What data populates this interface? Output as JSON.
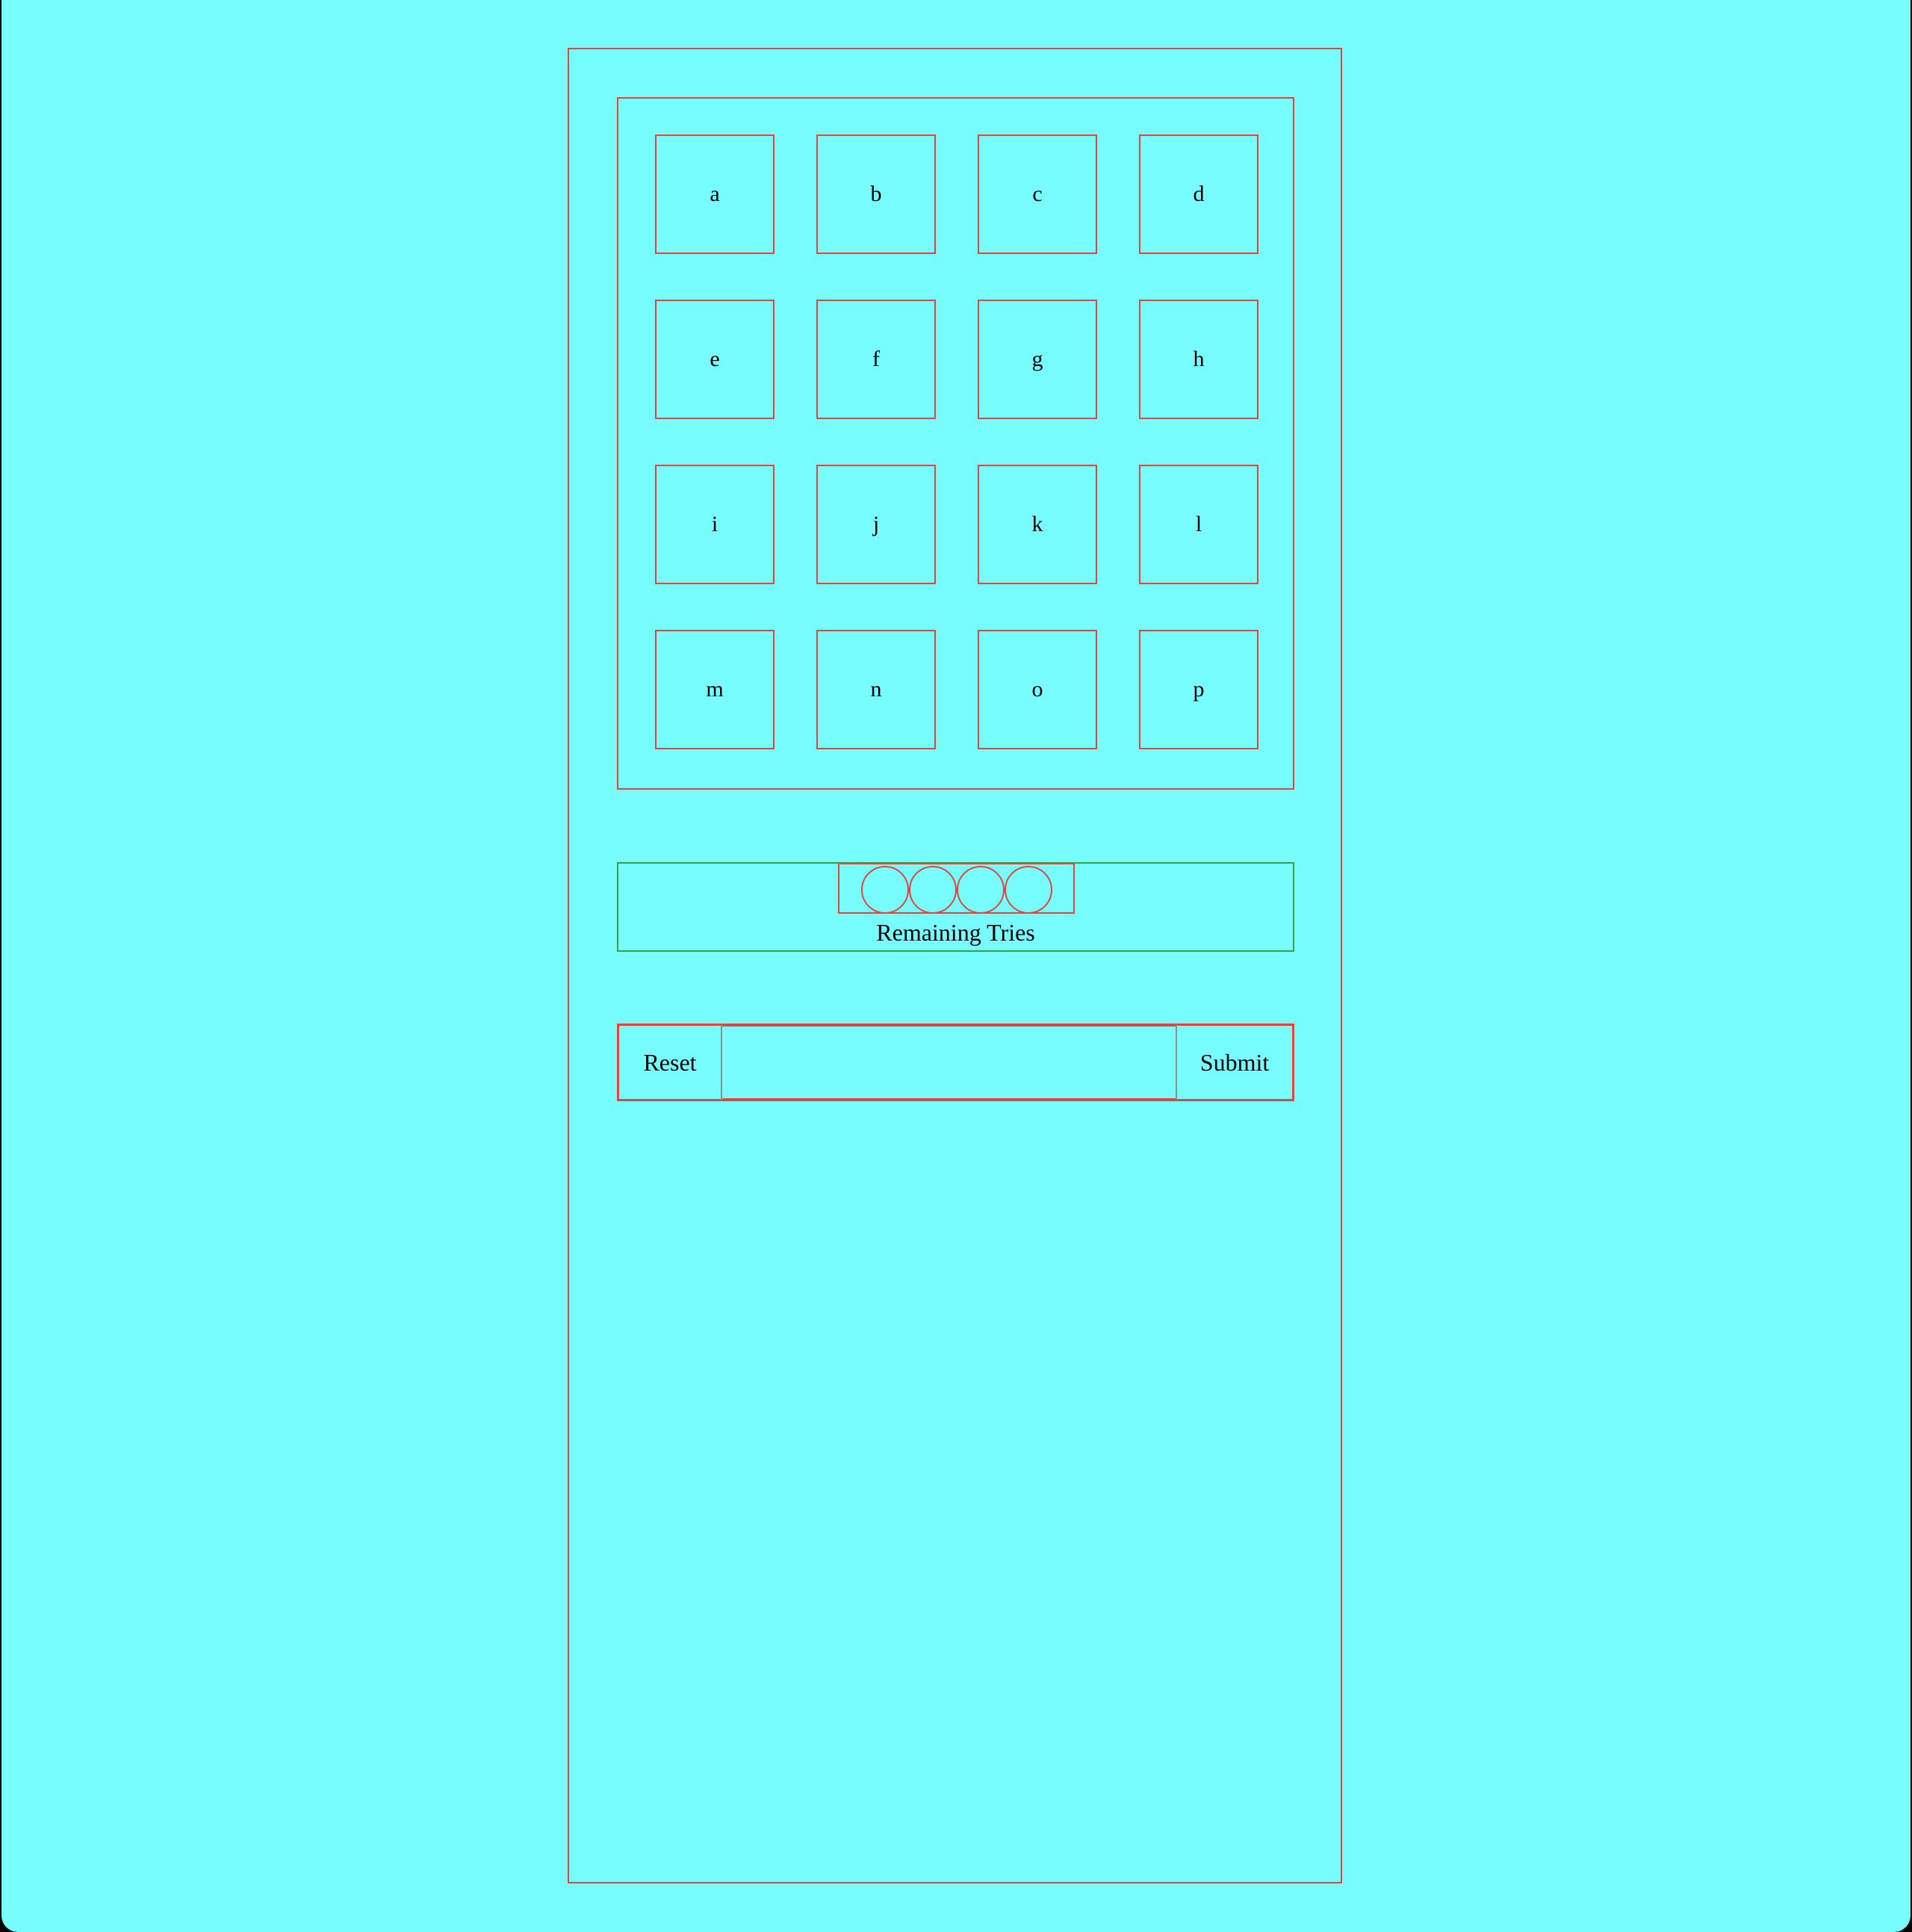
{
  "colors": {
    "background": "#77fdfe",
    "frame_border": "#e0463c",
    "tries_panel_border": "#37a14a"
  },
  "grid": {
    "tiles": [
      "a",
      "b",
      "c",
      "d",
      "e",
      "f",
      "g",
      "h",
      "i",
      "j",
      "k",
      "l",
      "m",
      "n",
      "o",
      "p"
    ]
  },
  "tries": {
    "label": "Remaining Tries",
    "remaining": 4
  },
  "controls": {
    "reset_label": "Reset",
    "submit_label": "Submit"
  }
}
